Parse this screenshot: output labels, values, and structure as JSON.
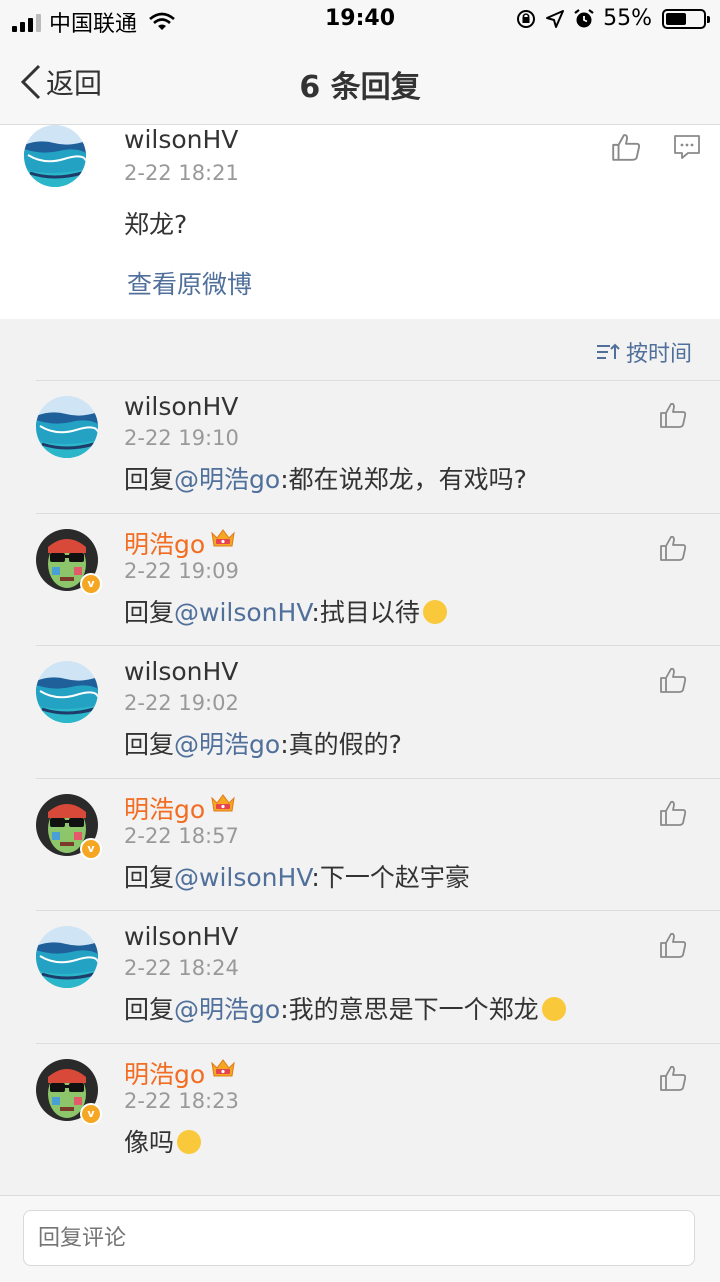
{
  "status_bar": {
    "carrier": "中国联通",
    "time": "19:40",
    "battery_pct": "55%",
    "battery_level": 0.55
  },
  "nav": {
    "back_label": "返回",
    "title": "6 条回复"
  },
  "root_comment": {
    "username": "wilsonHV",
    "time": "2-22 18:21",
    "text": "郑龙?",
    "view_original": "查看原微博"
  },
  "sort_label": "按时间",
  "replies": [
    {
      "username": "wilsonHV",
      "time": "2-22 19:10",
      "prefix": "回复",
      "mention": "@明浩go",
      "text": ":都在说郑龙，有戏吗?"
    },
    {
      "username": "明浩go",
      "time": "2-22 19:09",
      "prefix": "回复",
      "mention": "@wilsonHV",
      "text": ":拭目以待"
    },
    {
      "username": "wilsonHV",
      "time": "2-22 19:02",
      "prefix": "回复",
      "mention": "@明浩go",
      "text": ":真的假的?"
    },
    {
      "username": "明浩go",
      "time": "2-22 18:57",
      "prefix": "回复",
      "mention": "@wilsonHV",
      "text": ":下一个赵宇豪"
    },
    {
      "username": "wilsonHV",
      "time": "2-22 18:24",
      "prefix": "回复",
      "mention": "@明浩go",
      "text": ":我的意思是下一个郑龙"
    },
    {
      "username": "明浩go",
      "time": "2-22 18:23",
      "prefix": "",
      "mention": "",
      "text": "像吗"
    }
  ],
  "reply_input": {
    "placeholder": "回复评论"
  },
  "colors": {
    "link_blue": "#50709b",
    "vip_orange": "#f26d22",
    "verified_gold": "#f5a623"
  }
}
